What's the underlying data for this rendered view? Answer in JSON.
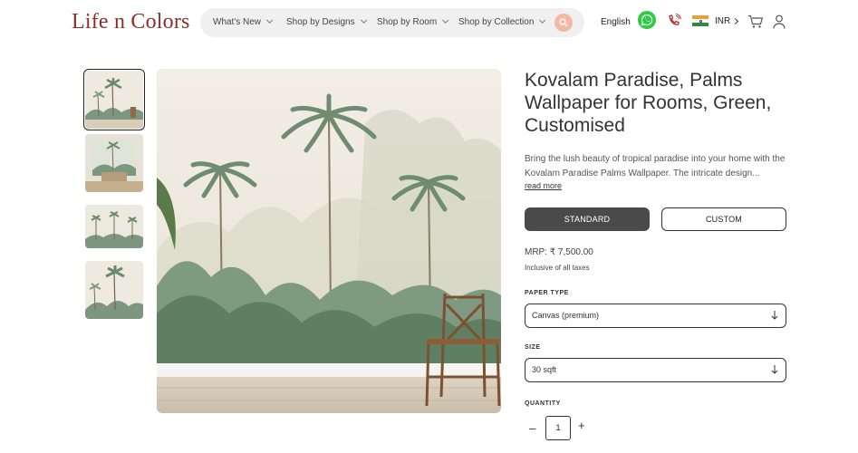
{
  "header": {
    "logo": "Life n Colors",
    "nav": [
      {
        "label": "What's New"
      },
      {
        "label": "Shop by Designs"
      },
      {
        "label": "Shop by Room"
      },
      {
        "label": "Shop by Collection"
      }
    ],
    "language": "English",
    "currency": "INR",
    "icons": [
      "search-icon",
      "whatsapp-icon",
      "phone-icon",
      "india-flag-icon",
      "cart-icon",
      "user-icon"
    ]
  },
  "gallery": {
    "thumbnails": [
      "palms-mural-thumb-1",
      "room-scene-thumb-2",
      "wide-mural-thumb-3",
      "palms-closeup-thumb-4"
    ],
    "active_index": 0
  },
  "product": {
    "title": "Kovalam Paradise, Palms Wallpaper for Rooms, Green, Customised",
    "description": "Bring the lush beauty of tropical paradise into your home with the Kovalam Paradise Palms Wallpaper. The intricate design...",
    "read_more": "read more",
    "size_options": {
      "standard": "STANDARD",
      "custom": "CUSTOM",
      "selected": "STANDARD"
    },
    "price": "MRP: ₹ 7,500.00",
    "tax_note": "Inclusive of all taxes",
    "paper_type": {
      "label": "PAPER TYPE",
      "value": "Canvas (premium)"
    },
    "size": {
      "label": "SIZE",
      "value": "30 sqft"
    },
    "quantity": {
      "label": "QUANTITY",
      "minus": "–",
      "value": "1",
      "plus": "+"
    }
  },
  "colors": {
    "brand": "#8c2f2a",
    "primary_button": "#4a4a4a",
    "search_accent": "#f4b9a6",
    "whatsapp": "#2ecc40"
  }
}
